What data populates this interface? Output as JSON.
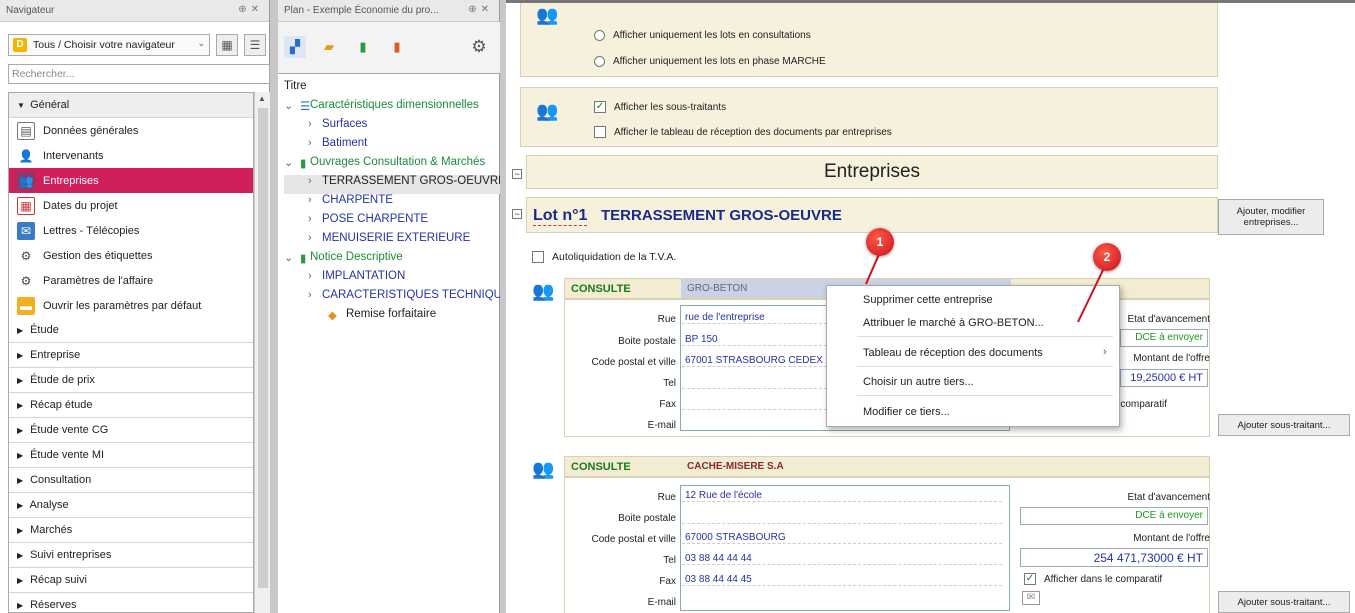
{
  "navigator": {
    "title": "Navigateur",
    "selector": "Tous / Choisir votre navigateur",
    "search_placeholder": "Rechercher...",
    "general_group": "Général",
    "general_items": [
      "Données générales",
      "Intervenants",
      "Entreprises",
      "Dates du projet",
      "Lettres - Télécopies",
      "Gestion des étiquettes",
      "Paramètres de l'affaire",
      "Ouvrir les paramètres par défaut"
    ],
    "groups": [
      "Étude",
      "Entreprise",
      "Étude de prix",
      "Récap étude",
      "Étude vente CG",
      "Étude vente MI",
      "Consultation",
      "Analyse",
      "Marchés",
      "Suivi entreprises",
      "Récap suivi",
      "Réserves"
    ]
  },
  "plan": {
    "title": "Plan - Exemple Économie du pro...",
    "tree_header": "Titre",
    "n1": "Caractéristiques dimensionnelles",
    "n1_children": [
      "Surfaces",
      "Batiment"
    ],
    "n2": "Ouvrages Consultation & Marchés",
    "n2_children": [
      "TERRASSEMENT GROS-OEUVRE",
      "CHARPENTE",
      "POSE CHARPENTE",
      "MENUISERIE EXTERIEURE"
    ],
    "n3": "Notice Descriptive",
    "n3_children": [
      "IMPLANTATION",
      "CARACTERISTIQUES TECHNIQUES"
    ],
    "n3_leaf": "Remise forfaitaire"
  },
  "main": {
    "opt_consult": "Afficher uniquement les lots en consultations",
    "opt_marche": "Afficher uniquement les lots en phase MARCHE",
    "opt_soustraitants": "Afficher les sous-traitants",
    "opt_tableau": "Afficher le tableau de réception des documents par entreprises",
    "section_title": "Entreprises",
    "lot_num": "Lot n°1",
    "lot_name": "TERRASSEMENT GROS-OEUVRE",
    "btn_ajouter_entreprises": "Ajouter, modifier entreprises...",
    "autoliq": "Autoliquidation de la T.V.A.",
    "btn_sous_traitant": "Ajouter sous-traitant...",
    "labels": {
      "rue": "Rue",
      "bp": "Boite postale",
      "cp": "Code postal et ville",
      "tel": "Tel",
      "fax": "Fax",
      "email": "E-mail",
      "etat": "Etat d'avancement",
      "montant": "Montant de l'offre",
      "comparatif": "Afficher dans le comparatif"
    },
    "c1": {
      "status": "CONSULTE",
      "name": "GRO-BETON",
      "rue": "rue de l'entreprise",
      "bp": "BP 150",
      "cp": "67001 STRASBOURG CEDEX",
      "etat": "DCE à envoyer",
      "montant": "19,25000 € HT",
      "comparatif": "e comparatif",
      "etat_label": "Etat d'avancement",
      "montant_label": "Montant de l'offre"
    },
    "c2": {
      "status": "CONSULTE",
      "name": "CACHE-MISERE S.A",
      "rue": "12 Rue de l'école",
      "bp": "",
      "cp": "67000 STRASBOURG",
      "tel": "03 88 44 44 44",
      "fax": "03 88 44 44 45",
      "etat": "DCE à envoyer",
      "montant": "254 471,73000 € HT"
    }
  },
  "context_menu": {
    "items": [
      "Supprimer cette entreprise",
      "Attribuer le marché à GRO-BETON...",
      "Tableau de réception des documents",
      "Choisir un autre tiers...",
      "Modifier ce tiers..."
    ]
  },
  "callouts": [
    "1",
    "2"
  ],
  "colors": {
    "selected": "#d0205c",
    "panel": "#f5f1dc",
    "value_text": "#2233aa",
    "title_blue": "#1a2a8a",
    "callout": "#d0101a"
  }
}
